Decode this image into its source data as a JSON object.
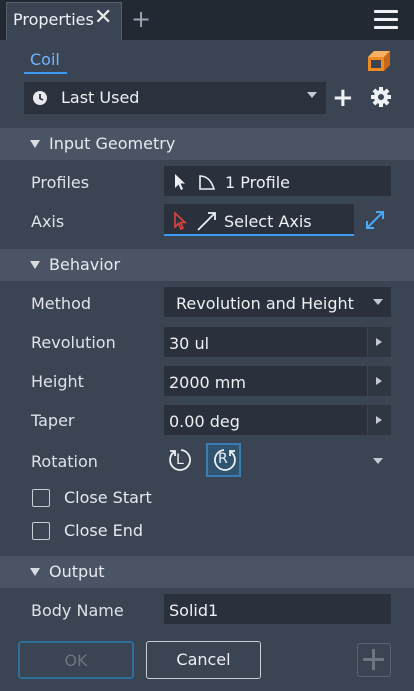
{
  "window": {
    "tab_title": "Properties",
    "close_glyph": "✕",
    "add_tab_glyph": "+",
    "menu_icon": "hamburger-menu-icon"
  },
  "header": {
    "command_tab": "Coil",
    "command_icon": "coil-cube-icon"
  },
  "preset": {
    "value": "Last Used",
    "icon": "clock-icon",
    "add_glyph": "+",
    "settings_icon": "gear-icon"
  },
  "input_geometry": {
    "title": "Input Geometry",
    "profiles_label": "Profiles",
    "profiles_value": "1 Profile",
    "axis_label": "Axis",
    "axis_value": "Select Axis",
    "flip_icon": "flip-direction-icon"
  },
  "behavior": {
    "title": "Behavior",
    "method_label": "Method",
    "method_value": "Revolution and Height",
    "revolution_label": "Revolution",
    "revolution_value": "30 ul",
    "height_label": "Height",
    "height_value": "2000 mm",
    "taper_label": "Taper",
    "taper_value": "0.00 deg",
    "rotation_label": "Rotation",
    "rotation_left_glyph": "L",
    "rotation_right_glyph": "R",
    "rotation_selected": "right",
    "close_start_label": "Close Start",
    "close_start_checked": false,
    "close_end_label": "Close End",
    "close_end_checked": false
  },
  "output": {
    "title": "Output",
    "body_name_label": "Body Name",
    "body_name_value": "Solid1"
  },
  "footer": {
    "ok_label": "OK",
    "cancel_label": "Cancel",
    "apply_glyph": "+"
  },
  "colors": {
    "panel": "#3b4453",
    "titlebar": "#222933",
    "section": "#4a5464",
    "field": "#2a313c",
    "accent": "#3d9bf2",
    "orange": "#f08a24",
    "red_cursor": "#e0413a"
  }
}
